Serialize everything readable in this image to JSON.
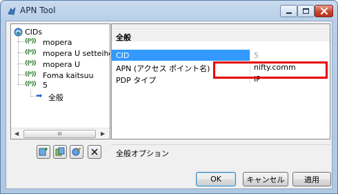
{
  "window": {
    "title": "APN Tool",
    "icon": "app-icon"
  },
  "tree": {
    "root_label": "CIDs",
    "items": [
      {
        "label": "mopera",
        "icon": "signal-icon"
      },
      {
        "label": "mopera U setteihenkou",
        "icon": "signal-icon"
      },
      {
        "label": "mopera U",
        "icon": "signal-icon"
      },
      {
        "label": "Foma kaitsuu",
        "icon": "signal-icon"
      },
      {
        "label": "5",
        "icon": "signal-icon"
      }
    ],
    "child_label": "全般",
    "scroll_thumb_grip": "III"
  },
  "property_grid": {
    "category": "全般",
    "rows": [
      {
        "name": "CID",
        "value": "5"
      },
      {
        "name": "APN (アクセス ポイント名)",
        "value": "nifty.comm"
      },
      {
        "name": "PDP タイプ",
        "value": "IP"
      }
    ]
  },
  "description": "全般オプション",
  "buttons": {
    "ok": "OK",
    "cancel": "キャンセル",
    "apply": "適用"
  },
  "colors": {
    "selection": "#3399ff",
    "highlight": "#e60000",
    "close_button": "#c9462f"
  }
}
